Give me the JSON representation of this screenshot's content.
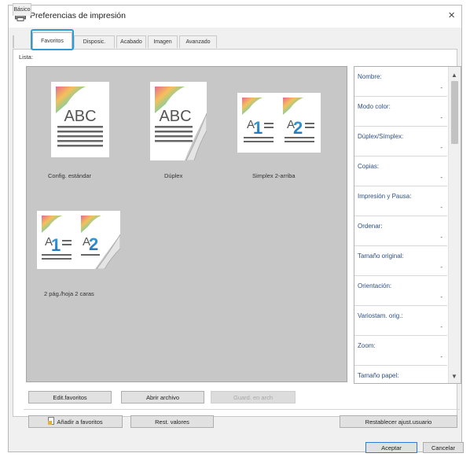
{
  "window": {
    "title": "Preferencias de impresión",
    "close_glyph": "×",
    "title_icon": "printer-icon"
  },
  "tabs": [
    {
      "label": "Básico",
      "active": false
    },
    {
      "label": "Favoritos",
      "active": true
    },
    {
      "label": "Disposic.",
      "active": false
    },
    {
      "label": "Acabado",
      "active": false
    },
    {
      "label": "Imagen",
      "active": false
    },
    {
      "label": "Avanzado",
      "active": false
    }
  ],
  "lista_label": "Lista:",
  "favorites": [
    {
      "label": "Config. estándar",
      "thumb": "abc-simplex-icon"
    },
    {
      "label": "Dúplex",
      "thumb": "abc-duplex-icon"
    },
    {
      "label": "Simplex 2-arriba",
      "thumb": "two-up-simplex-icon"
    },
    {
      "label": "2 pág./hoja 2 caras",
      "thumb": "two-up-duplex-icon"
    }
  ],
  "thumb_text": {
    "abc": "ABC",
    "a": "A",
    "one": "1",
    "two": "2"
  },
  "properties": [
    {
      "name": "Nombre:",
      "value": "-"
    },
    {
      "name": "Modo color:",
      "value": "-"
    },
    {
      "name": "Dúplex/Símplex:",
      "value": "-"
    },
    {
      "name": "Copias:",
      "value": "-"
    },
    {
      "name": "Impresión y Pausa:",
      "value": "-"
    },
    {
      "name": "Ordenar:",
      "value": "-"
    },
    {
      "name": "Tamaño original:",
      "value": "-"
    },
    {
      "name": "Orientación:",
      "value": "-"
    },
    {
      "name": "Variostam. orig.:",
      "value": "-"
    },
    {
      "name": "Zoom:",
      "value": "-"
    },
    {
      "name": "Tamaño papel:",
      "value": ""
    }
  ],
  "buttons": {
    "edit_favorites": "Edit.favoritos",
    "open_file": "Abrir archivo",
    "save_to_file": "Guard. en arch",
    "add_to_favorites": "Añadir a favoritos",
    "reset_values": "Rest. valores",
    "restore_user": "Restablecer ajust.usuario",
    "accept": "Aceptar",
    "cancel": "Cancelar"
  },
  "colors": {
    "accent": "#2f9bd2",
    "gallery_bg": "#c7c7c7",
    "property_label": "#2e4f86"
  }
}
